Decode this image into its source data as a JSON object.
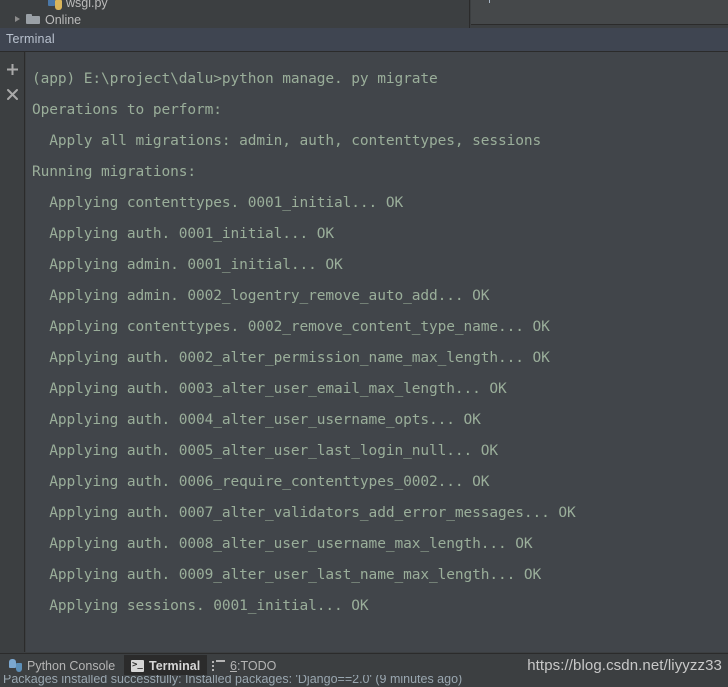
{
  "project_tree": {
    "items": [
      {
        "label": "wsgi.py",
        "icon": "python-file-icon",
        "has_arrow": false
      },
      {
        "label": "Online",
        "icon": "folder-icon",
        "has_arrow": true
      }
    ]
  },
  "tool_window": {
    "title": "Terminal",
    "toolbar": {
      "add_label": "+",
      "close_label": "×",
      "add_name": "new-session-button",
      "close_name": "close-session-button"
    }
  },
  "terminal": {
    "lines": [
      "(app) E:\\project\\dalu>python manage. py migrate",
      "Operations to perform:",
      "  Apply all migrations: admin, auth, contenttypes, sessions",
      "Running migrations:",
      "  Applying contenttypes. 0001_initial... OK",
      "  Applying auth. 0001_initial... OK",
      "  Applying admin. 0001_initial... OK",
      "  Applying admin. 0002_logentry_remove_auto_add... OK",
      "  Applying contenttypes. 0002_remove_content_type_name... OK",
      "  Applying auth. 0002_alter_permission_name_max_length... OK",
      "  Applying auth. 0003_alter_user_email_max_length... OK",
      "  Applying auth. 0004_alter_user_username_opts... OK",
      "  Applying auth. 0005_alter_user_last_login_null... OK",
      "  Applying auth. 0006_require_contenttypes_0002... OK",
      "  Applying auth. 0007_alter_validators_add_error_messages... OK",
      "  Applying auth. 0008_alter_user_username_max_length... OK",
      "  Applying auth. 0009_alter_user_last_name_max_length... OK",
      "  Applying sessions. 0001_initial... OK"
    ],
    "text_color": "#9aae9a",
    "background": "#41454a"
  },
  "statusbar": {
    "tabs": [
      {
        "label": "Python Console",
        "icon": "python-console-icon",
        "active": false
      },
      {
        "label": "Terminal",
        "icon": "terminal-icon",
        "active": true
      },
      {
        "label": "TODO",
        "icon": "todo-list-icon",
        "number": "6",
        "separator": ": ",
        "active": false
      }
    ]
  },
  "watermark": {
    "text": "https://blog.csdn.net/liyyzz33"
  },
  "bottom_message": {
    "text": "Packages installed successfully: Installed packages: 'Django==2.0' (9 minutes ago)"
  }
}
